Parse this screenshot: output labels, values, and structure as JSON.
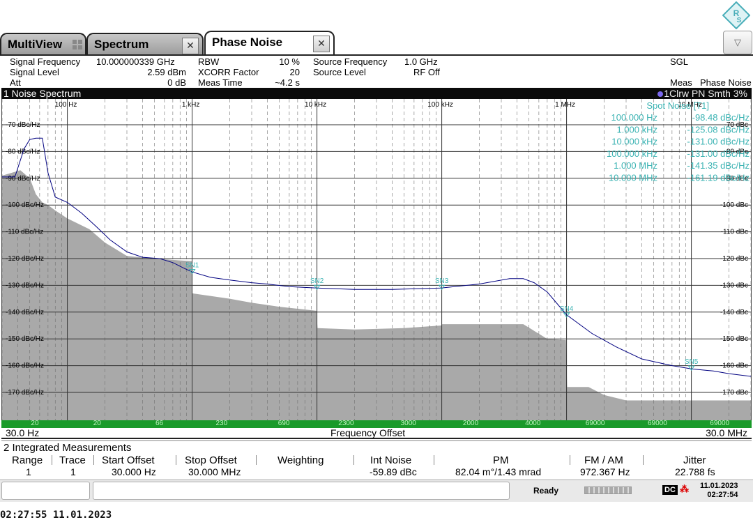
{
  "tabs": [
    {
      "label": "MultiView"
    },
    {
      "label": "Spectrum"
    },
    {
      "label": "Phase Noise"
    }
  ],
  "settings": {
    "signal_frequency": {
      "label": "Signal Frequency",
      "value": "10.000000339 GHz"
    },
    "signal_level": {
      "label": "Signal Level",
      "value": "2.59 dBm"
    },
    "att": {
      "label": "Att",
      "value": "0 dB"
    },
    "rbw": {
      "label": "RBW",
      "value": "10 %"
    },
    "xcorr": {
      "label": "XCORR Factor",
      "value": "20"
    },
    "meas_time": {
      "label": "Meas Time",
      "value": "~4.2 s"
    },
    "source_frequency": {
      "label": "Source Frequency",
      "value": "1.0 GHz"
    },
    "source_level": {
      "label": "Source Level",
      "value": "RF Off"
    },
    "sgl": "SGL",
    "meas": {
      "label": "Meas",
      "value": "Phase Noise"
    }
  },
  "diagram": {
    "title": "1 Noise Spectrum",
    "trace_info": "1Clrw PN Smth 3%",
    "start_label": "30.0 Hz",
    "stop_label": "30.0 MHz",
    "x_axis_label": "Frequency Offset",
    "green_bar_values": [
      "20",
      "20",
      "66",
      "230",
      "690",
      "2300",
      "3000",
      "2000",
      "4000",
      "69000",
      "69000",
      "69000"
    ]
  },
  "spot_noise": {
    "title": "Spot Noise [T1]",
    "rows": [
      {
        "freq": "100.000 Hz",
        "value": "-98.48 dBc/Hz"
      },
      {
        "freq": "1.000 kHz",
        "value": "-125.08 dBc/Hz"
      },
      {
        "freq": "10.000 kHz",
        "value": "-131.00 dBc/Hz"
      },
      {
        "freq": "100.000 kHz",
        "value": "-131.00 dBc/Hz"
      },
      {
        "freq": "1.000 MHz",
        "value": "-141.35 dBc/Hz"
      },
      {
        "freq": "10.000 MHz",
        "value": "-161.19 dBc/Hz"
      }
    ]
  },
  "chart_data": {
    "type": "line",
    "x_scale": "log",
    "xlim": [
      30,
      30000000
    ],
    "ylim": [
      -180,
      -60
    ],
    "x_tick_labels": [
      "100 Hz",
      "1 kHz",
      "10 kHz",
      "100 kHz",
      "1 MHz",
      "10 MHz"
    ],
    "x_ticks": [
      100,
      1000,
      10000,
      100000,
      1000000,
      10000000
    ],
    "y_ticks": [
      -70,
      -80,
      -90,
      -100,
      -110,
      -120,
      -130,
      -140,
      -150,
      -160,
      -170
    ],
    "y_tick_labels_left": [
      "-70 dBc/Hz",
      "-80 dBc/Hz",
      "-90 dBc/Hz",
      "-100 dBc/Hz",
      "-110 dBc/Hz",
      "-120 dBc/Hz",
      "-130 dBc/Hz",
      "-140 dBc/Hz",
      "-150 dBc/Hz",
      "-160 dBc/Hz",
      "-170 dBc/Hz"
    ],
    "y_tick_labels_right": [
      "-70 dBc",
      "-80 dBc",
      "-90 dBc",
      "-100 dBc",
      "-110 dBc",
      "-120 dBc",
      "-130 dBc",
      "-140 dBc",
      "-150 dBc",
      "-160 dBc",
      "-170 dBc"
    ],
    "grid": true,
    "series": [
      {
        "kind": "line",
        "color": "#000080",
        "x": [
          30,
          38,
          45,
          50,
          56,
          63,
          70,
          80,
          100,
          130,
          170,
          220,
          300,
          400,
          550,
          700,
          850,
          1000,
          1400,
          2000,
          3000,
          4000,
          6000,
          10000,
          20000,
          40000,
          70000,
          100000,
          200000,
          350000,
          450000,
          550000,
          700000,
          1000000,
          1600000,
          2500000,
          4000000,
          7000000,
          10000000,
          15000000,
          20000000,
          30000000
        ],
        "y": [
          -89.5,
          -89.5,
          -79,
          -75.5,
          -75,
          -75,
          -88,
          -97,
          -99,
          -103,
          -108,
          -113,
          -117.5,
          -119.5,
          -120,
          -121.5,
          -123.5,
          -125,
          -127,
          -128,
          -129,
          -129.5,
          -130.5,
          -131,
          -131.5,
          -131.5,
          -131.2,
          -131,
          -129.5,
          -127.5,
          -127.5,
          -129,
          -132.5,
          -141,
          -148,
          -153,
          -157.5,
          -160,
          -161.2,
          -162,
          -163,
          -164
        ]
      },
      {
        "kind": "area",
        "color": "#a9a9a9",
        "x": [
          30,
          42,
          50,
          56,
          63,
          70,
          80,
          100,
          150,
          200,
          300,
          500,
          700,
          999,
          1001,
          2000,
          3000,
          5000,
          9900,
          10100,
          20000,
          50000,
          99000,
          101000,
          150000,
          300000,
          450000,
          550000,
          700000,
          990000,
          1010000,
          1500000,
          2000000,
          3000000,
          30000000
        ],
        "y": [
          -89,
          -87,
          -90,
          -96,
          -99,
          -100,
          -102,
          -105,
          -109,
          -114,
          -119,
          -120,
          -120.5,
          -121,
          -133,
          -135,
          -136.5,
          -138,
          -139.5,
          -146,
          -146.5,
          -146,
          -145,
          -144.5,
          -144.5,
          -144.5,
          -144.5,
          -147,
          -150,
          -150.5,
          -168,
          -168,
          -171,
          -173,
          -173
        ]
      }
    ],
    "markers": [
      {
        "label": "SN1",
        "x": 1000,
        "y": -125.08
      },
      {
        "label": "SN2",
        "x": 10000,
        "y": -131.0
      },
      {
        "label": "SN3",
        "x": 100000,
        "y": -131.0
      },
      {
        "label": "SN4",
        "x": 1000000,
        "y": -141.35
      },
      {
        "label": "SN5",
        "x": 10000000,
        "y": -161.19
      }
    ]
  },
  "integrated": {
    "title": "2 Integrated Measurements",
    "headers": [
      "Range",
      "Trace",
      "Start Offset",
      "Stop Offset",
      "Weighting",
      "Int Noise",
      "PM",
      "FM / AM",
      "Jitter"
    ],
    "row": [
      "1",
      "1",
      "30.000 Hz",
      "30.000 MHz",
      "",
      "-59.89 dBc",
      "82.04 m°/1.43 mrad",
      "972.367 Hz",
      "22.788 fs"
    ]
  },
  "status": {
    "ready": "Ready",
    "dc": "DC",
    "date": "11.01.2023",
    "time": "02:27:54"
  },
  "photo_timestamp": "02:27:55 11.01.2023"
}
